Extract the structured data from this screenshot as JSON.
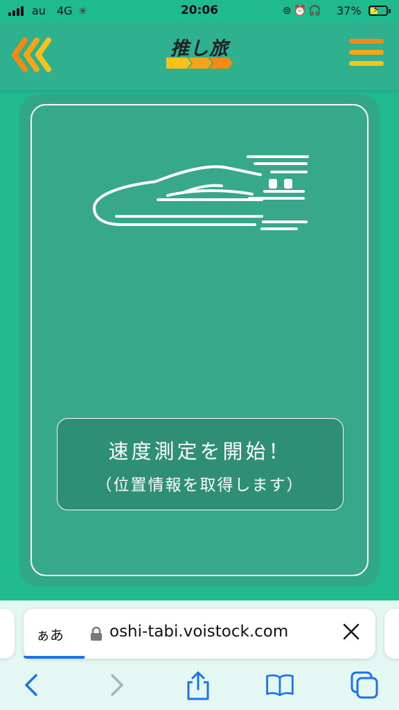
{
  "status_bar": {
    "carrier": "au",
    "network": "4G",
    "time": "20:06",
    "battery_percent": "37%",
    "icons": [
      "orientation-lock-icon",
      "alarm-icon",
      "headphones-icon",
      "battery-charging-icon"
    ]
  },
  "header": {
    "logo_text": "推し旅",
    "back_icon": "triple-chevron-left-icon",
    "menu_icon": "hamburger-menu-icon",
    "colors": {
      "orange": "#f58a12",
      "yellow": "#f8c21a",
      "header_bg": "#2fb08e"
    }
  },
  "main": {
    "illustration": "bullet-train-icon",
    "start_button": {
      "label": "速度測定を開始！",
      "sublabel": "（位置情報を取得します）"
    },
    "colors": {
      "page_bg": "#1fba8e",
      "card_bg": "#37a98a",
      "button_bg": "#2e8f74"
    }
  },
  "browser": {
    "reader_label": "ぁあ",
    "url": "oshi-tabi.voistock.com",
    "toolbar": [
      "back-icon",
      "forward-icon",
      "share-icon",
      "bookmarks-icon",
      "tabs-icon"
    ],
    "accent": "#1a73e8"
  }
}
